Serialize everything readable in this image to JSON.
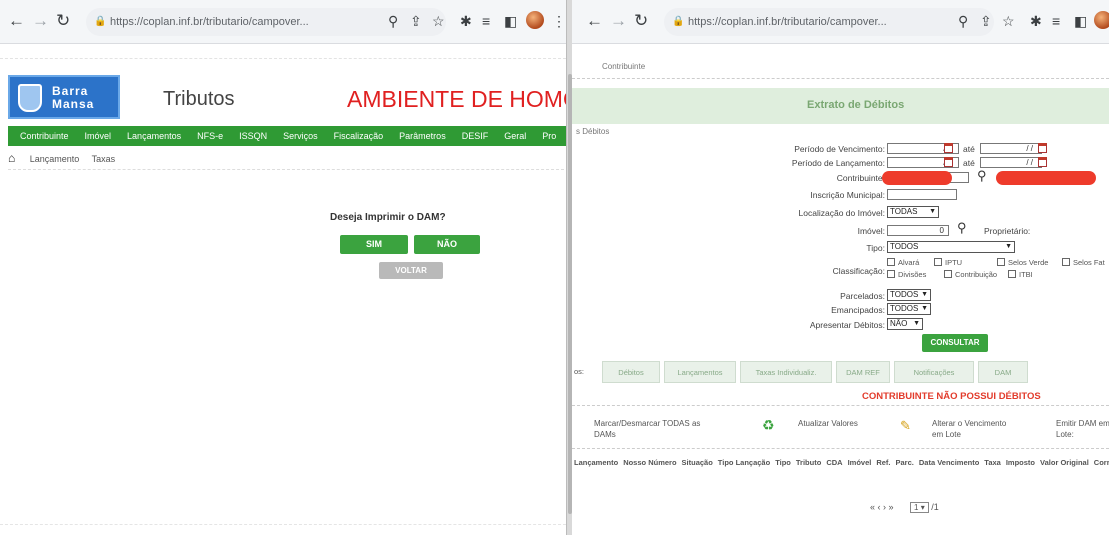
{
  "left_window": {
    "url": "https://coplan.inf.br/tributario/campover...",
    "logo_line1": "Barra",
    "logo_line2": "Mansa",
    "app_title": "Tributos",
    "env_title": "AMBIENTE DE HOMO",
    "menu": [
      "Contribuinte",
      "Imóvel",
      "Lançamentos",
      "NFS-e",
      "ISSQN",
      "Serviços",
      "Fiscalização",
      "Parâmetros",
      "DESIF",
      "Geral",
      "Pro"
    ],
    "breadcrumb": [
      "Lançamento",
      "Taxas"
    ],
    "dialog": {
      "question": "Deseja Imprimir o DAM?",
      "yes": "SIM",
      "no": "NÃO",
      "back": "VOLTAR"
    }
  },
  "right_window": {
    "url": "https://coplan.inf.br/tributario/campover...",
    "crumb": "Contribuinte",
    "banner_title": "Extrato de Débitos",
    "side_label": "s Débitos",
    "form": {
      "venc_label": "Período de Vencimento:",
      "lanc_label": "Período de Lançamento:",
      "date_placeholder": "/ /",
      "ate": "até",
      "contribuinte_label": "Contribuinte:",
      "inscricao_label": "Inscrição Municipal:",
      "localizacao_label": "Localização do Imóvel:",
      "localizacao_value": "TODAS",
      "imovel_label": "Imóvel:",
      "imovel_value": "0",
      "proprietario_label": "Proprietário:",
      "tipo_label": "Tipo:",
      "tipo_value": "TODOS",
      "classificacao_label": "Classificação:",
      "classificacoes": [
        "Alvará",
        "IPTU",
        "Selos Verde",
        "Selos Fat",
        "Divisões",
        "Contribuição",
        "ITBI"
      ],
      "parcelados_label": "Parcelados:",
      "parcelados_value": "TODOS",
      "emancipados_label": "Emancipados:",
      "emancipados_value": "TODOS",
      "apresentar_label": "Apresentar Débitos:",
      "apresentar_value": "NÃO",
      "consultar": "CONSULTAR"
    },
    "tabs": [
      "Débitos",
      "Lançamentos",
      "Taxas Individualiz.",
      "DAM REF",
      "Notificações",
      "DAM"
    ],
    "tab_prefix": "os:",
    "no_debt_message": "CONTRIBUINTE NÃO POSSUI DÉBITOS",
    "actions": {
      "mark": "Marcar/Desmarcar TODAS as DAMs",
      "refresh": "Atualizar Valores",
      "change_due": "Alterar o Vencimento em Lote",
      "emit": "Emitir DAM em Lote:"
    },
    "table_headers": [
      "Lançamento",
      "Nosso Número",
      "Situação",
      "Tipo Lançação",
      "Tipo",
      "Tributo",
      "CDA",
      "Imóvel",
      "Ref.",
      "Parc.",
      "Data Vencimento",
      "Taxa",
      "Imposto",
      "Valor Original",
      "Correção"
    ],
    "pager": {
      "controls": "« ‹ › »",
      "page": "1",
      "total": "/1"
    }
  }
}
